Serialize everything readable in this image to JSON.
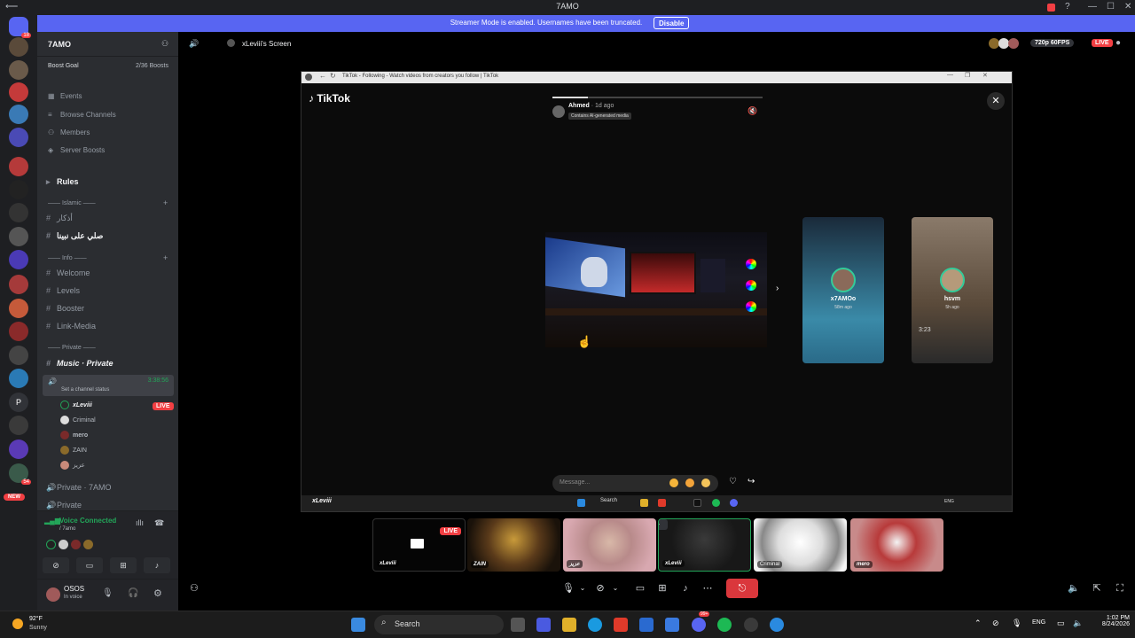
{
  "window": {
    "title": "7AMO",
    "minimize": "—",
    "maximize": "☐",
    "close": "✕"
  },
  "banner": {
    "message": "Streamer Mode is enabled. Usernames have been truncated.",
    "button": "Disable"
  },
  "server_rail": {
    "dm_badge": "18",
    "badges": [
      "54",
      "99+"
    ],
    "letter_server": "P",
    "new_label": "NEW"
  },
  "sidebar": {
    "guild_name": "7AMO",
    "boost_goal_label": "Boost Goal",
    "boost_goal_value": "2/36 Boosts",
    "nav": [
      {
        "label": "Events",
        "icon": "calendar-icon"
      },
      {
        "label": "Browse Channels",
        "icon": "browse-icon"
      },
      {
        "label": "Members",
        "icon": "members-icon"
      },
      {
        "label": "Server Boosts",
        "icon": "boost-icon"
      }
    ],
    "channels": {
      "rules": "Rules",
      "cat_islamic": "Islamic",
      "ch_athkar": "أذكار",
      "ch_salli": "صلي على نبينا",
      "cat_info": "Info",
      "ch_welcome": "Welcome",
      "ch_levels": "Levels",
      "ch_booster": "Booster",
      "ch_linkmedia": "Link-Media",
      "cat_private": "Private",
      "ch_music": "Music · Private",
      "voice_timer": "3:38:56",
      "voice_status": "Set a channel status",
      "voice_users": [
        "xLeviii",
        "Criminal",
        "mero",
        "ZAIN",
        "عزيز"
      ],
      "live_label": "LIVE",
      "ch_private_7amo": "Private · 7AMO",
      "ch_private": "Private"
    },
    "voice_panel": {
      "status": "Voice Connected",
      "location": "/ 7amo"
    },
    "user_panel": {
      "name": "OSOS",
      "status": "In voice"
    }
  },
  "stream": {
    "title": "xLeviii's Screen",
    "quality": "720p 60FPS",
    "live": "LIVE"
  },
  "browser": {
    "tab_title": "TikTok - Following - Watch videos from creators you follow | TikTok"
  },
  "tiktok": {
    "logo": "TikTok",
    "progress": 0.17,
    "author": "Ahmed",
    "posted": "· 1d ago",
    "ai_label": "Contains AI-generated media",
    "message_placeholder": "Message...",
    "side_cards": [
      {
        "name": "x7AMOo",
        "ago": "58m ago"
      },
      {
        "name": "hsvm",
        "ago": "5h ago"
      }
    ],
    "timestamp": "3:23"
  },
  "remote_taskbar": {
    "name": "xLeviii",
    "search": "Search",
    "lang": "ENG"
  },
  "tiles": [
    {
      "name": "xLeviii",
      "live": "LIVE"
    },
    {
      "name": "ZAIN"
    },
    {
      "name": "عزيز"
    },
    {
      "name": "xLeviii"
    },
    {
      "name": "Criminal"
    },
    {
      "name": "mero"
    }
  ],
  "taskbar": {
    "temp": "92°F",
    "condition": "Sunny",
    "search": "Search",
    "lang": "ENG",
    "time": "1:02 PM",
    "date": "8/24/2026",
    "discord_badge": "99+"
  },
  "colors": {
    "blurple": "#5865f2",
    "live_red": "#f23f43",
    "sidebar": "#2b2d31"
  }
}
